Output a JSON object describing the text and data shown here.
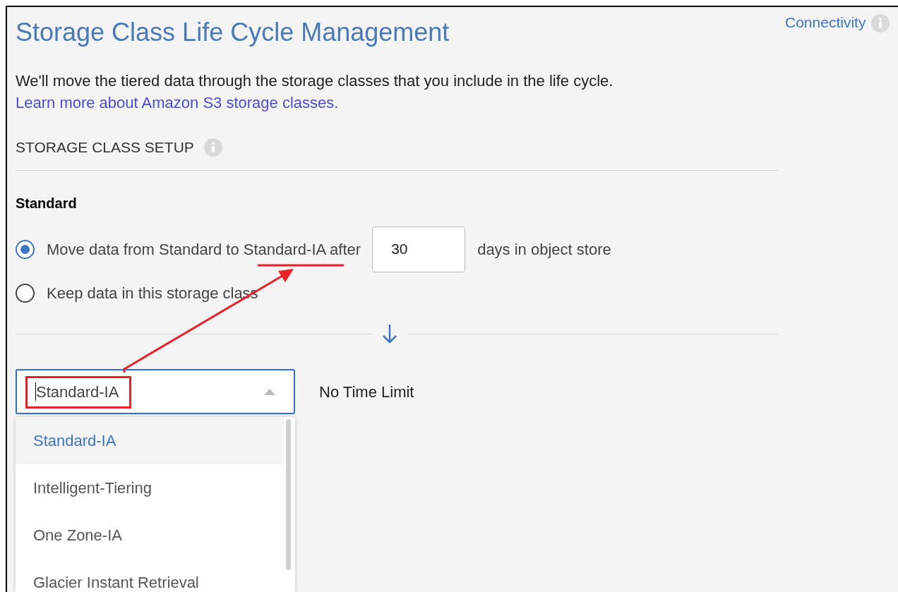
{
  "header": {
    "title": "Storage Class Life Cycle Management",
    "link": "Connectivity"
  },
  "intro": {
    "text": "We'll move the tiered data through the storage classes that you include in the life cycle.",
    "link": "Learn more about Amazon S3 storage classes."
  },
  "section": {
    "heading": "STORAGE CLASS SETUP"
  },
  "standard": {
    "heading": "Standard",
    "options": [
      {
        "kind": "move",
        "label": "Move data from Standard to Standard-IA after",
        "days": "30",
        "days_label": "days in object store",
        "selected": true
      },
      {
        "kind": "keep",
        "label": "Keep data in this storage class",
        "selected": false
      }
    ]
  },
  "next_tier": {
    "select": {
      "value": "Standard-IA",
      "expanded": true,
      "options": [
        {
          "label": "Standard-IA",
          "highlighted": true
        },
        {
          "label": "Intelligent-Tiering",
          "highlighted": false
        },
        {
          "label": "One Zone-IA",
          "highlighted": false
        },
        {
          "label": "Glacier Instant Retrieval",
          "highlighted": false
        }
      ]
    },
    "limit": "No Time Limit"
  }
}
